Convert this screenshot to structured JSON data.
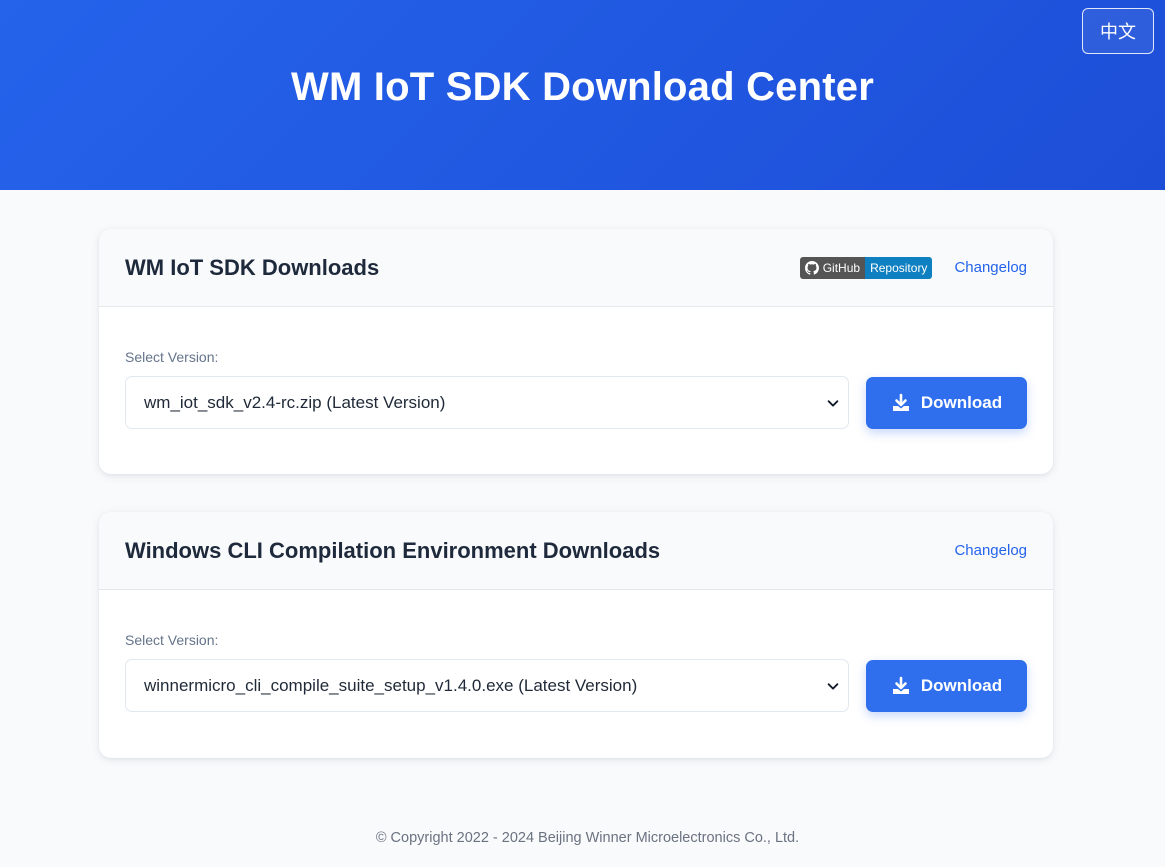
{
  "header": {
    "title": "WM IoT SDK Download Center",
    "lang_button": "中文"
  },
  "sdk_card": {
    "title": "WM IoT SDK Downloads",
    "badge_left": "GitHub",
    "badge_right": "Repository",
    "changelog": "Changelog",
    "select_label": "Select Version:",
    "selected_version": "wm_iot_sdk_v2.4-rc.zip (Latest Version)",
    "download_label": "Download"
  },
  "cli_card": {
    "title": "Windows CLI Compilation Environment Downloads",
    "changelog": "Changelog",
    "select_label": "Select Version:",
    "selected_version": "winnermicro_cli_compile_suite_setup_v1.4.0.exe (Latest Version)",
    "download_label": "Download"
  },
  "footer": {
    "copyright": "© Copyright 2022 - 2024 Beijing Winner Microelectronics Co., Ltd."
  },
  "colors": {
    "header_bg": "#2563eb",
    "accent": "#2f6fee",
    "link": "#2563eb",
    "badge_left": "#555555",
    "badge_right": "#0e7fc0"
  }
}
